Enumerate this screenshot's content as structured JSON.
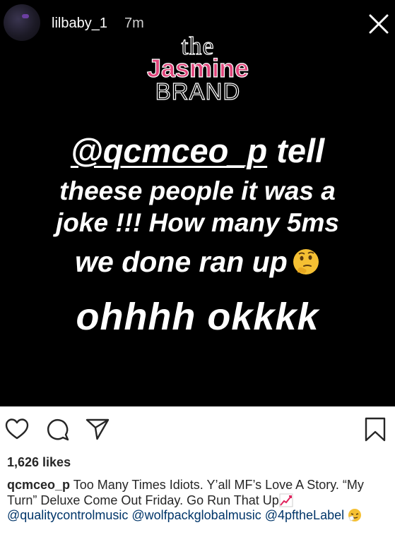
{
  "story": {
    "username": "lilbaby_1",
    "time": "7m",
    "watermark": {
      "the": "the",
      "jasmine": "Jasmine",
      "brand": "BRAND"
    },
    "lines": {
      "line1_mention": "@qcmceo_p",
      "line1_rest": " tell",
      "line2": "theese people it was a",
      "line3": "joke !!! How many 5ms",
      "line4": "we done ran up",
      "line5": "ohhhh okkkk"
    },
    "emoji": "thinking-face-icon"
  },
  "post": {
    "likes": "1,626 likes",
    "caption_user": "qcmceo_p",
    "caption_text": " Too Many Times Idiots. Y’all MF’s Love A Story. “My Turn” Deluxe Come Out Friday. Go Run That Up",
    "tags": [
      "@qualitycontrolmusic",
      "@wolfpackglobalmusic",
      "@4pftheLabel"
    ]
  },
  "colors": {
    "story_bg": "#000000",
    "text": "#262626",
    "watermark_pink": "#e0457b",
    "tag": "#003569"
  }
}
